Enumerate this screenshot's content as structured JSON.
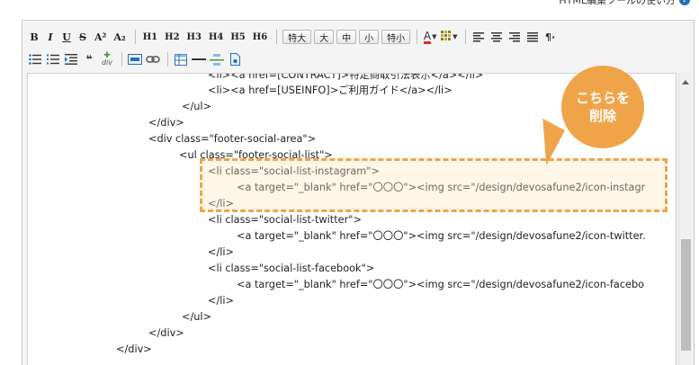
{
  "header": {
    "help_link": "HTML編集ツールの使い方",
    "help_icon": "?"
  },
  "toolbar": {
    "row1": {
      "bold": "B",
      "italic": "I",
      "underline": "U",
      "strike": "S",
      "superscript": "A²",
      "subscript": "A₂",
      "headings": [
        "H1",
        "H2",
        "H3",
        "H4",
        "H5",
        "H6"
      ],
      "sizes": [
        "特大",
        "大",
        "中",
        "小",
        "特小"
      ],
      "text_color": "A"
    },
    "row2": {
      "quote": "❝",
      "div": "div"
    }
  },
  "code_lines": [
    "<li><a href=[CONTRACT]>特定商取引法表示</a></li>",
    "<li><a href=[USEINFO]>ご利用ガイド</a></li>",
    "</ul>",
    "</div>",
    "<div class=\"footer-social-area\">",
    "<ul class=\"footer-social-list\">",
    "<li class=\"social-list-instagram\">",
    "<a target=\"_blank\" href=\"〇〇〇\"><img src=\"/design/devosafune2/icon-instagr",
    "</li>",
    "<li class=\"social-list-twitter\">",
    "<a target=\"_blank\" href=\"〇〇〇\"><img src=\"/design/devosafune2/icon-twitter.",
    "</li>",
    "<li class=\"social-list-facebook\">",
    "<a target=\"_blank\" href=\"〇〇〇\"><img src=\"/design/devosafune2/icon-facebo",
    "</li>",
    "</ul>",
    "</div>",
    "</div>"
  ],
  "callout": {
    "line1": "こちらを",
    "line2": "削除"
  },
  "colors": {
    "accent_orange": "#f0a449",
    "text_color_underline": "#d9312b"
  }
}
